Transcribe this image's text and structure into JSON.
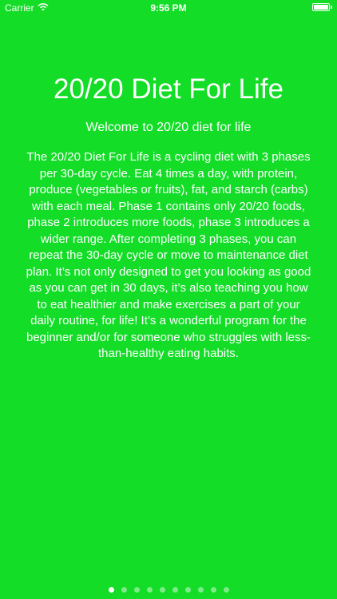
{
  "status_bar": {
    "carrier": "Carrier",
    "time": "9:56 PM",
    "icons": [
      "wifi-icon",
      "battery-icon"
    ]
  },
  "screen": {
    "title": "20/20 Diet For Life",
    "subtitle": "Welcome to 20/20 diet for life",
    "body": "The 20/20 Diet For Life is a cycling diet with 3 phases per 30-day cycle. Eat 4 times a day, with protein, produce (vegetables or fruits), fat, and starch (carbs) with each meal. Phase 1 contains only 20/20 foods, phase 2 introduces more foods, phase 3 introduces a wider range. After completing 3 phases, you can repeat the 30-day cycle or move to maintenance diet plan. It’s not only designed to get you looking as good as you can get in 30 days, it’s also teaching you how to eat healthier and make exercises a part of your daily routine, for life! It’s a wonderful program for the beginner and/or for someone who struggles with less-than-healthy eating habits."
  },
  "pager": {
    "page_count": 10,
    "current_page": 1
  },
  "colors": {
    "background": "#13dd27",
    "text": "#ffffff"
  }
}
